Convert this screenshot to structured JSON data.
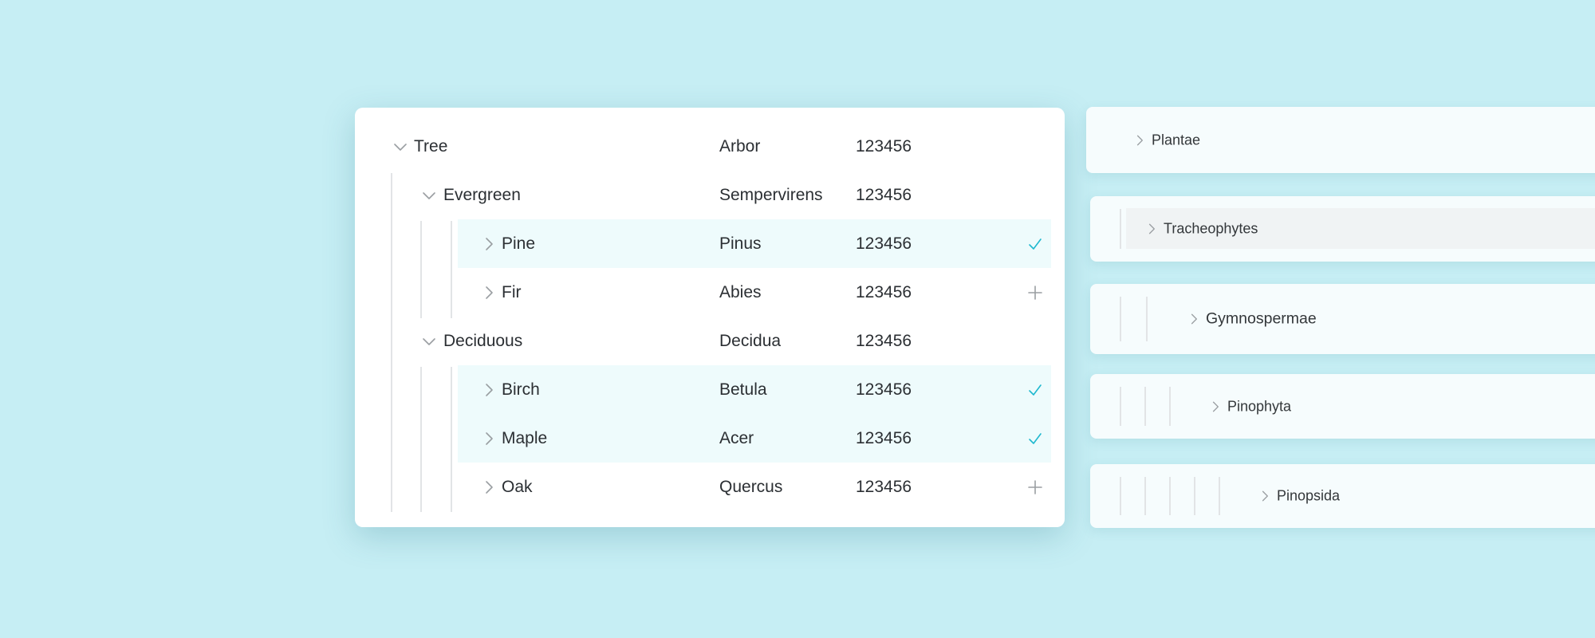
{
  "tree": {
    "rows": [
      {
        "name": "Tree",
        "latin": "Arbor",
        "code": "123456",
        "expanded": true,
        "level": 0,
        "selected": false,
        "action": null
      },
      {
        "name": "Evergreen",
        "latin": "Sempervirens",
        "code": "123456",
        "expanded": true,
        "level": 1,
        "selected": false,
        "action": null
      },
      {
        "name": "Pine",
        "latin": "Pinus",
        "code": "123456",
        "expanded": false,
        "level": 2,
        "selected": true,
        "action": "check-icon"
      },
      {
        "name": "Fir",
        "latin": "Abies",
        "code": "123456",
        "expanded": false,
        "level": 2,
        "selected": false,
        "action": "plus-icon"
      },
      {
        "name": "Deciduous",
        "latin": "Decidua",
        "code": "123456",
        "expanded": true,
        "level": 1,
        "selected": false,
        "action": null
      },
      {
        "name": "Birch",
        "latin": "Betula",
        "code": "123456",
        "expanded": false,
        "level": 2,
        "selected": true,
        "action": "check-icon"
      },
      {
        "name": "Maple",
        "latin": "Acer",
        "code": "123456",
        "expanded": false,
        "level": 2,
        "selected": true,
        "action": "check-icon"
      },
      {
        "name": "Oak",
        "latin": "Quercus",
        "code": "123456",
        "expanded": false,
        "level": 2,
        "selected": false,
        "action": "plus-icon"
      }
    ]
  },
  "hierarchy": {
    "items": [
      {
        "label": "Plantae",
        "depth": 0
      },
      {
        "label": "Tracheophytes",
        "depth": 1,
        "hovered": true
      },
      {
        "label": "Gymnospermae",
        "depth": 2
      },
      {
        "label": "Pinophyta",
        "depth": 3
      },
      {
        "label": "Pinopsida",
        "depth": 5
      }
    ]
  },
  "colors": {
    "background": "#c6eef4",
    "accent": "#1fb8cf",
    "selected_row": "#eefbfc",
    "hover_row": "#f0f3f4"
  }
}
